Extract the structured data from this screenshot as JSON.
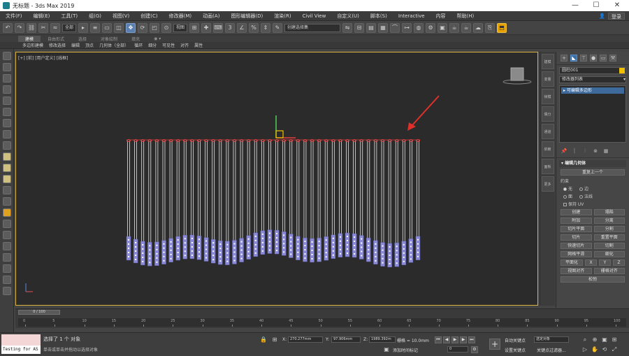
{
  "window": {
    "title": "无标题 - 3ds Max 2019",
    "controls": [
      "—",
      "☐",
      "✕"
    ]
  },
  "menu": {
    "items": [
      "文件(F)",
      "编辑(E)",
      "工具(T)",
      "组(G)",
      "视图(V)",
      "创建(C)",
      "修改器(M)",
      "动画(A)",
      "图形编辑器(D)",
      "渲染(R)",
      "Civil View",
      "自定义(U)",
      "脚本(S)",
      "Interactive",
      "内容",
      "帮助(H)"
    ],
    "user": "登录",
    "user_icon": "user-icon"
  },
  "toolbar": {
    "selection_filter": "全部",
    "view_select": "视图",
    "named_selection": "创建选择集"
  },
  "ribbon": {
    "tabs": [
      "建模",
      "自由形式",
      "选择",
      "对象绘制",
      "填充"
    ],
    "row": [
      "多边形建模",
      "修改选择",
      "编辑",
      "顶点",
      "几何体（全部）",
      "循环",
      "细分",
      "可见性",
      "对齐",
      "属性"
    ]
  },
  "viewport": {
    "label": "[+] [前] [用户定义] [线框]",
    "border_color": "#d8b43e",
    "bg_color": "#2b2b2b"
  },
  "right_strip": {
    "items": [
      "建模",
      "变量",
      "帧模",
      "偶分",
      "通道",
      "依赖",
      "面板",
      "更多"
    ]
  },
  "command_panel": {
    "object_name": "圆柱001",
    "modifier_list": "修改器列表",
    "stack_item": "可编辑多边形",
    "rollout_title": "编辑几何体",
    "repeat_last": "重复上一个",
    "constraints_label": "约束",
    "constraint_options": [
      "无",
      "边",
      "面",
      "法线"
    ],
    "preserve_uv": "保持 UV",
    "buttons": [
      [
        "创建",
        "塌陷"
      ],
      [
        "附加",
        "分离"
      ],
      [
        "切片平面",
        "分割"
      ],
      [
        "切片",
        "重置平面"
      ],
      [
        "快速切片",
        "切割"
      ],
      [
        "网格平滑",
        "细化"
      ],
      [
        "平面化",
        "X",
        "Y",
        "Z"
      ],
      [
        "视图对齐",
        "栅格对齐"
      ],
      [
        "松弛"
      ]
    ]
  },
  "timeline": {
    "frame_display": "0 / 100",
    "ticks": [
      "0",
      "5",
      "10",
      "15",
      "20",
      "25",
      "30",
      "35",
      "40",
      "45",
      "50",
      "55",
      "60",
      "65",
      "70",
      "75",
      "80",
      "85",
      "90",
      "95",
      "100"
    ]
  },
  "status": {
    "maxscript_label": "Testing for AS",
    "line1": "选择了 1 个 对象",
    "line2": "单击或单击并拖动以选择对象",
    "x_label": "X:",
    "x_value": "270.277mm",
    "y_label": "Y:",
    "y_value": "97.906mm",
    "z_label": "Z:",
    "z_value": "1989.392m",
    "grid": "栅格 = 10.0mm",
    "add_time_tag": "添加时间标记",
    "auto_key": "自动关键点",
    "selected_object": "选定对象",
    "set_key": "设置关键点",
    "key_filter": "关键点过滤器..."
  },
  "colors": {
    "cylinder_fill": "#8a8ad6",
    "cylinder_top": "#e04040",
    "wire": "#e6e6e6",
    "arrow": "#e0302a",
    "gizmo_yellow": "#f2c100",
    "gizmo_green": "#55d055",
    "gizmo_red": "#e04040"
  }
}
